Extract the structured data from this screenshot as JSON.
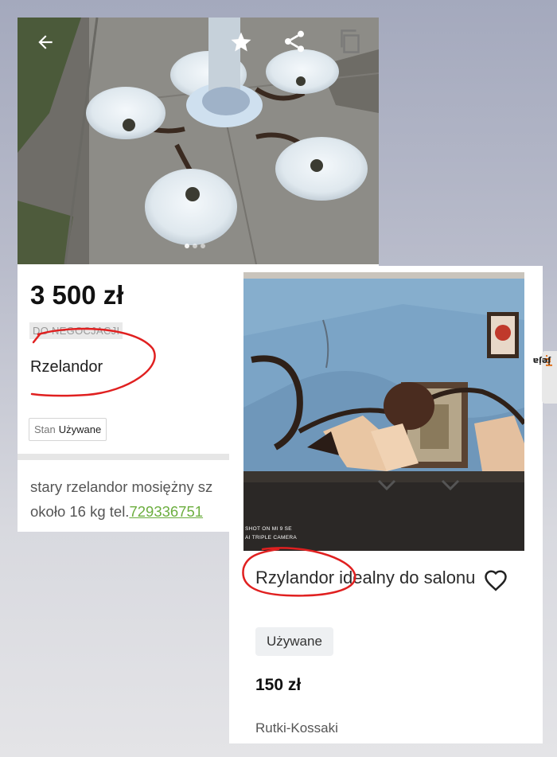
{
  "listing_1": {
    "price": "3 500 zł",
    "negotiable_label": "DO NEGOCJACJI",
    "title": "Rzelandor",
    "condition_key": "Stan",
    "condition_value": "Używane",
    "description_line1": "stary rzelandor mosiężny sz",
    "description_line2_prefix": "około 16 kg tel.",
    "phone": "729336751",
    "photo_icons": [
      "back-arrow-icon",
      "star-icon",
      "share-icon",
      "copy-icon"
    ],
    "photo_count_dots": 3
  },
  "listing_2": {
    "watermark_line1": "SHOT ON MI 9 SE",
    "watermark_line2": "AI TRIPLE CAMERA",
    "title": "Rzylandor idealny do salonu",
    "condition": "Używane",
    "price": "150 zł",
    "location": "Rutki-Kossaki"
  },
  "site_watermark": {
    "prefix": "jeja",
    "suffix": ".pl"
  },
  "colors": {
    "annotation_red": "#e02020",
    "phone_green": "#6cae3f",
    "accent_orange": "#e0701a"
  }
}
